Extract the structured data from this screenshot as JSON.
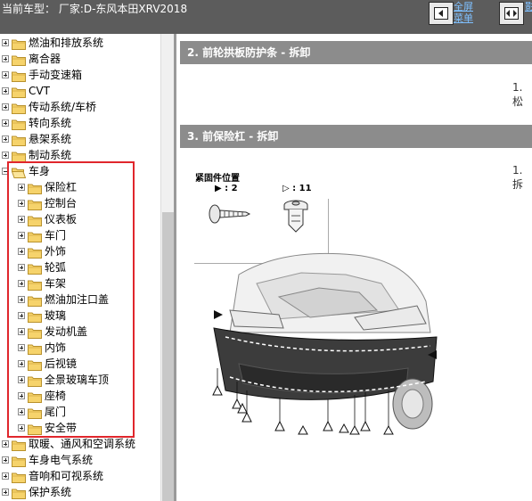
{
  "header": {
    "vehicle_label": "当前车型：  厂家:D-东风本田XRV2018",
    "btn1_label_line1": "全屏",
    "btn1_label_line2": "菜单",
    "btn2_label": "影"
  },
  "tree": {
    "top_items": [
      {
        "label": "燃油和排放系统"
      },
      {
        "label": "离合器"
      },
      {
        "label": "手动变速箱"
      },
      {
        "label": "CVT"
      },
      {
        "label": "传动系统/车桥"
      },
      {
        "label": "转向系统"
      },
      {
        "label": "悬架系统"
      },
      {
        "label": "制动系统"
      }
    ],
    "expanded": {
      "label": "车身"
    },
    "children": [
      {
        "label": "保险杠"
      },
      {
        "label": "控制台"
      },
      {
        "label": "仪表板"
      },
      {
        "label": "车门"
      },
      {
        "label": "外饰"
      },
      {
        "label": "轮弧"
      },
      {
        "label": "车架"
      },
      {
        "label": "燃油加注口盖"
      },
      {
        "label": "玻璃"
      },
      {
        "label": "发动机盖"
      },
      {
        "label": "内饰"
      },
      {
        "label": "后视镜"
      },
      {
        "label": "全景玻璃车顶"
      },
      {
        "label": "座椅"
      },
      {
        "label": "尾门"
      },
      {
        "label": "安全带"
      }
    ],
    "bottom_items": [
      {
        "label": "取暖、通风和空调系统"
      },
      {
        "label": "车身电气系统"
      },
      {
        "label": "音响和可视系统"
      },
      {
        "label": "保护系统"
      }
    ]
  },
  "content": {
    "section2_title": "2. 前轮拱板防护条 - 拆卸",
    "section2_step": "1.  松",
    "section3_title": "3. 前保险杠 - 拆卸",
    "section3_step": "1.  拆",
    "fasteners_title": "紧固件位置",
    "fastener_screw": "▶ : 2",
    "fastener_clip": "▷ : 11"
  },
  "colors": {
    "header_bg": "#5c5c5c",
    "section_bar": "#8c8c8c",
    "highlight_box": "#e0262c",
    "link": "#7fc0ff"
  }
}
